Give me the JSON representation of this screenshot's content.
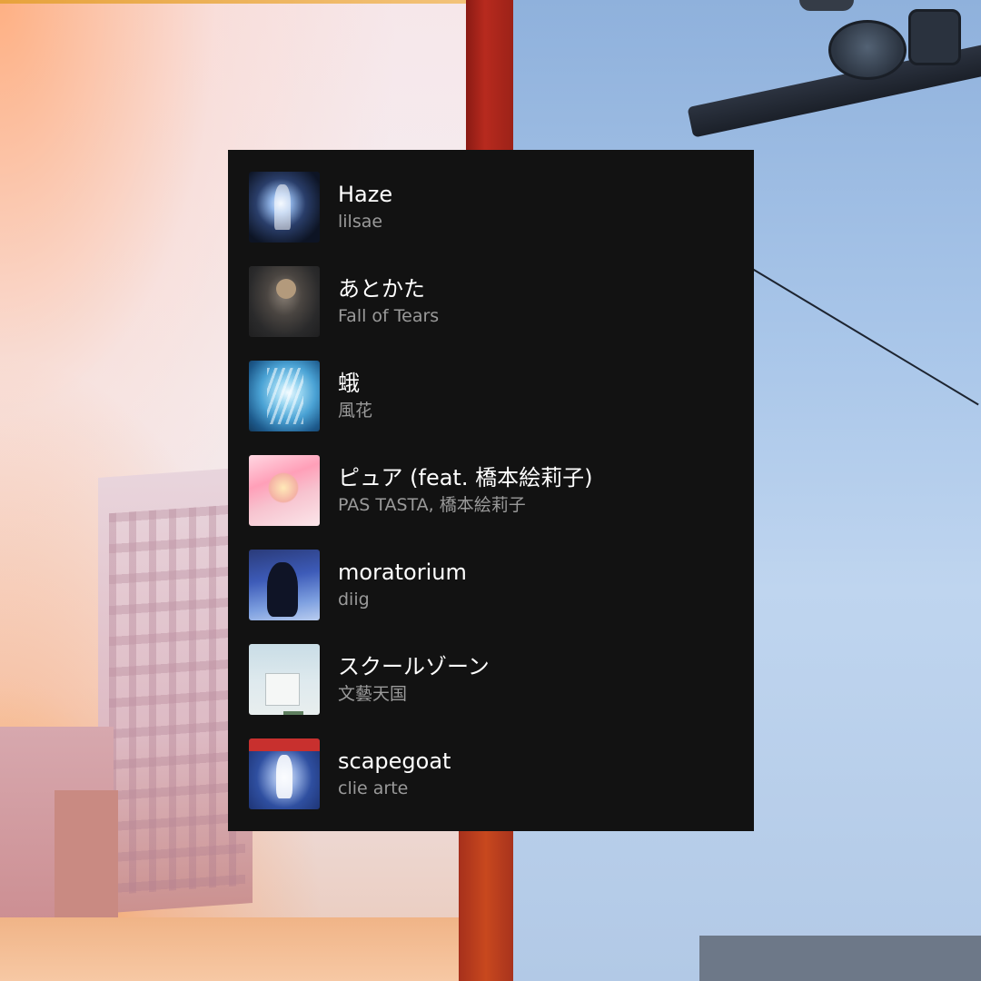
{
  "playlist": {
    "tracks": [
      {
        "title": "Haze",
        "artist": "lilsae",
        "cover_icon": "album-cover-haze"
      },
      {
        "title": "あとかた",
        "artist": "Fall of Tears",
        "cover_icon": "album-cover-atokata"
      },
      {
        "title": "蛾",
        "artist": "風花",
        "cover_icon": "album-cover-ga"
      },
      {
        "title": "ピュア (feat. 橋本絵莉子)",
        "artist": "PAS TASTA, 橋本絵莉子",
        "cover_icon": "album-cover-pure"
      },
      {
        "title": "moratorium",
        "artist": "diig",
        "cover_icon": "album-cover-moratorium"
      },
      {
        "title": "スクールゾーン",
        "artist": "文藝天国",
        "cover_icon": "album-cover-school-zone"
      },
      {
        "title": "scapegoat",
        "artist": "clie arte",
        "cover_icon": "album-cover-scapegoat"
      }
    ]
  },
  "colors": {
    "panel_background": "#121212",
    "title_text": "#ffffff",
    "artist_text": "#9a9a9a"
  }
}
